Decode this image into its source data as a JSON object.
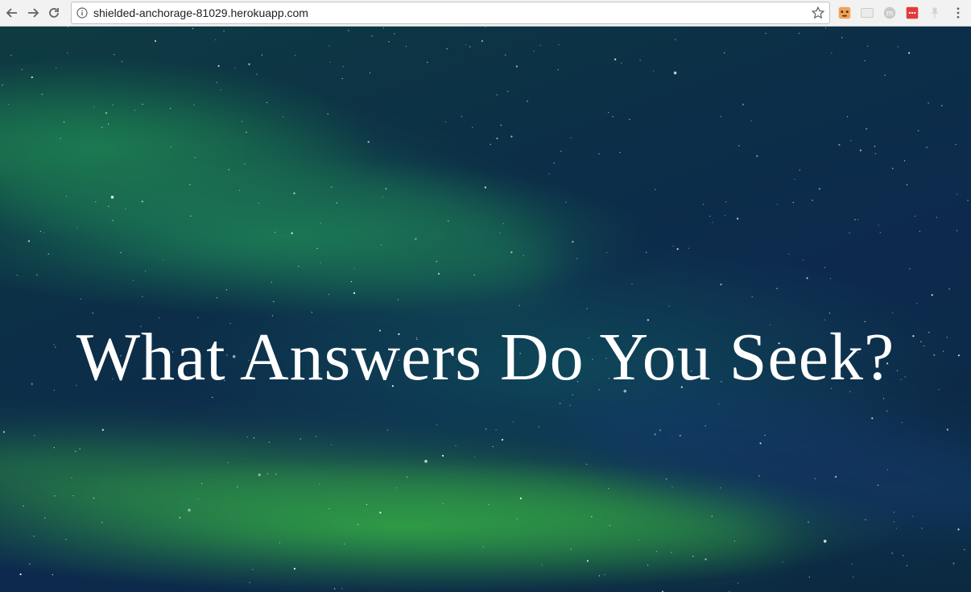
{
  "browser": {
    "url": "shielded-anchorage-81029.herokuapp.com",
    "nav_icons": [
      "back-icon",
      "forward-icon",
      "reload-icon"
    ],
    "extensions": [
      "face-extension-icon",
      "card-extension-icon",
      "m-extension-icon",
      "red-extension-icon",
      "pin-extension-icon"
    ]
  },
  "page": {
    "heading": "What Answers Do You Seek?",
    "background_colors": {
      "deep_blue": "#0d2a4e",
      "teal": "#0e3b42",
      "aurora_green": "#34aa46"
    }
  }
}
